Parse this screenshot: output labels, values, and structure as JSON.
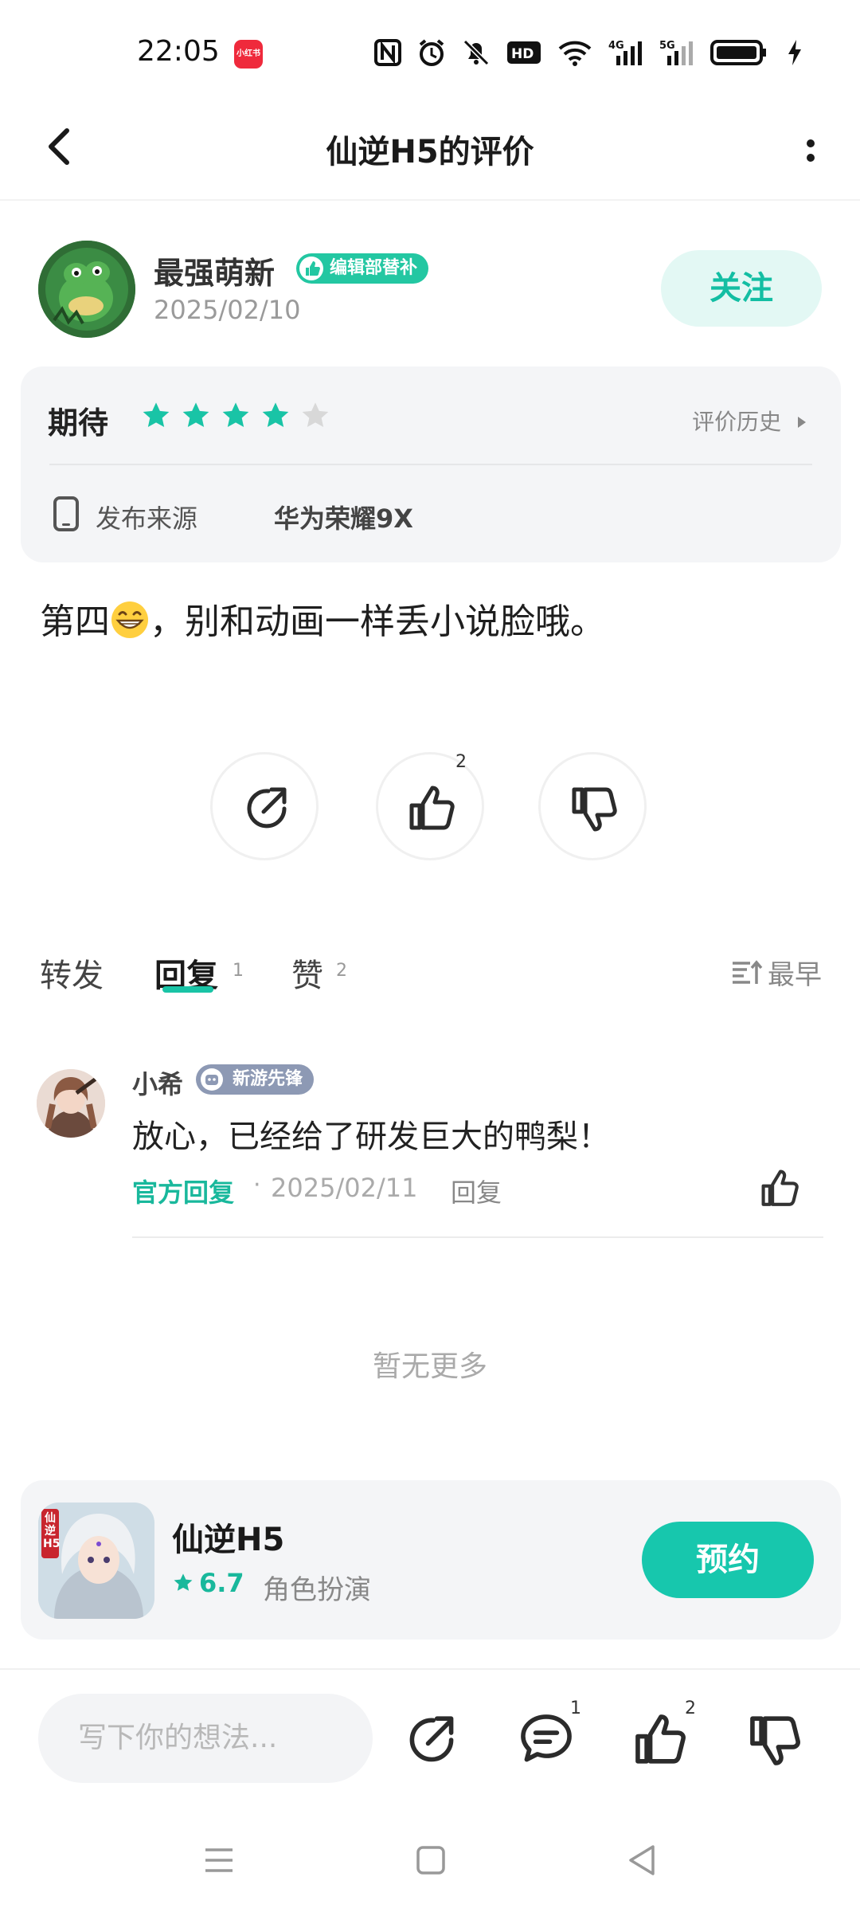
{
  "status_bar": {
    "time": "22:05",
    "app_badge": "小红书"
  },
  "header": {
    "title": "仙逆H5的评价"
  },
  "author": {
    "name": "最强萌新",
    "badge": "编辑部替补",
    "date": "2025/02/10",
    "follow_label": "关注"
  },
  "rating": {
    "label": "期待",
    "stars": 4,
    "max_stars": 5,
    "history_label": "评价历史",
    "source_label": "发布来源",
    "source_value": "华为荣耀9X"
  },
  "review": {
    "text_before_emoji": "第四",
    "emoji": "grinning-face",
    "text_after_emoji": "，别和动画一样丢小说脸哦。"
  },
  "actions": {
    "like_count": "2"
  },
  "tabs": [
    {
      "label": "转发",
      "count": ""
    },
    {
      "label": "回复",
      "count": "1"
    },
    {
      "label": "赞",
      "count": "2"
    }
  ],
  "sort_label": "最早",
  "comment": {
    "name": "小希",
    "badge": "新游先锋",
    "text": "放心，已经给了研发巨大的鸭梨！",
    "official_label": "官方回复",
    "separator": "·",
    "date": "2025/02/11",
    "reply_label": "回复"
  },
  "no_more": "暂无更多",
  "game": {
    "name": "仙逆H5",
    "score": "6.7",
    "genre": "角色扮演",
    "reserve_label": "预约",
    "icon_text": "仙逆H5"
  },
  "bottom_bar": {
    "placeholder": "写下你的想法...",
    "comment_count": "1",
    "like_count": "2"
  },
  "colors": {
    "accent": "#19c4a6",
    "star_empty": "#d8d8d8",
    "card_bg": "#f4f5f7"
  },
  "icons": [
    "back-icon",
    "more-icon",
    "star-icon",
    "phone-icon",
    "share-icon",
    "thumb-up-icon",
    "thumb-down-icon",
    "sort-icon",
    "comment-icon",
    "menu-icon",
    "home-icon",
    "back-triangle-icon"
  ]
}
